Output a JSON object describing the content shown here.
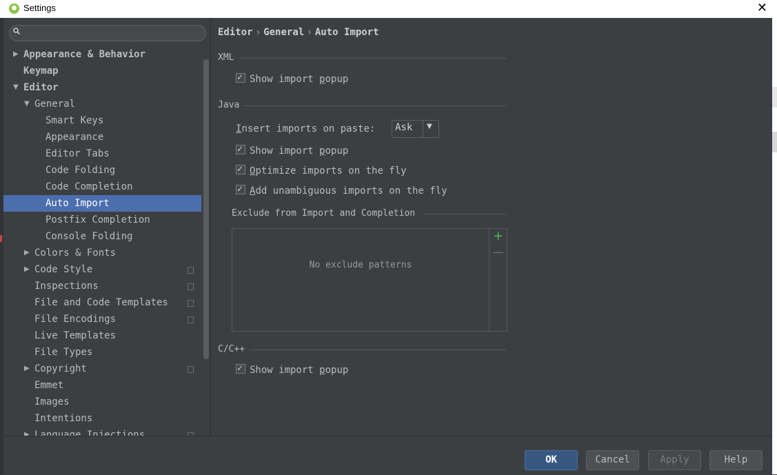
{
  "window": {
    "title": "Settings",
    "close": "✕"
  },
  "search": {
    "placeholder": "",
    "value": ""
  },
  "tree": [
    {
      "label": "Appearance & Behavior",
      "bold": true,
      "level": 0,
      "arrow": "▶",
      "project": false
    },
    {
      "label": "Keymap",
      "bold": true,
      "level": 0,
      "arrow": "",
      "project": false
    },
    {
      "label": "Editor",
      "bold": true,
      "level": 0,
      "arrow": "▼",
      "project": false
    },
    {
      "label": "General",
      "bold": false,
      "level": 1,
      "arrow": "▼",
      "project": false
    },
    {
      "label": "Smart Keys",
      "bold": false,
      "level": 2,
      "arrow": "",
      "project": false
    },
    {
      "label": "Appearance",
      "bold": false,
      "level": 2,
      "arrow": "",
      "project": false
    },
    {
      "label": "Editor Tabs",
      "bold": false,
      "level": 2,
      "arrow": "",
      "project": false
    },
    {
      "label": "Code Folding",
      "bold": false,
      "level": 2,
      "arrow": "",
      "project": false
    },
    {
      "label": "Code Completion",
      "bold": false,
      "level": 2,
      "arrow": "",
      "project": false
    },
    {
      "label": "Auto Import",
      "bold": false,
      "level": 2,
      "arrow": "",
      "project": false,
      "selected": true
    },
    {
      "label": "Postfix Completion",
      "bold": false,
      "level": 2,
      "arrow": "",
      "project": false
    },
    {
      "label": "Console Folding",
      "bold": false,
      "level": 2,
      "arrow": "",
      "project": false
    },
    {
      "label": "Colors & Fonts",
      "bold": false,
      "level": 1,
      "arrow": "▶",
      "project": false
    },
    {
      "label": "Code Style",
      "bold": false,
      "level": 1,
      "arrow": "▶",
      "project": true
    },
    {
      "label": "Inspections",
      "bold": false,
      "level": 1,
      "arrow": "",
      "project": true
    },
    {
      "label": "File and Code Templates",
      "bold": false,
      "level": 1,
      "arrow": "",
      "project": true
    },
    {
      "label": "File Encodings",
      "bold": false,
      "level": 1,
      "arrow": "",
      "project": true
    },
    {
      "label": "Live Templates",
      "bold": false,
      "level": 1,
      "arrow": "",
      "project": false
    },
    {
      "label": "File Types",
      "bold": false,
      "level": 1,
      "arrow": "",
      "project": false
    },
    {
      "label": "Copyright",
      "bold": false,
      "level": 1,
      "arrow": "▶",
      "project": true
    },
    {
      "label": "Emmet",
      "bold": false,
      "level": 1,
      "arrow": "",
      "project": false
    },
    {
      "label": "Images",
      "bold": false,
      "level": 1,
      "arrow": "",
      "project": false
    },
    {
      "label": "Intentions",
      "bold": false,
      "level": 1,
      "arrow": "",
      "project": false
    },
    {
      "label": "Language Injections",
      "bold": false,
      "level": 1,
      "arrow": "▶",
      "project": true
    }
  ],
  "breadcrumb": {
    "a": "Editor",
    "b": "General",
    "c": "Auto Import",
    "sep": "›"
  },
  "xml": {
    "title": "XML",
    "show_popup": {
      "pre": "Show import ",
      "u": "p",
      "post": "opup",
      "checked": true
    }
  },
  "java": {
    "title": "Java",
    "insert_label_u": "I",
    "insert_label_rest": "nsert imports on paste:",
    "insert_value": "Ask",
    "show_popup": {
      "pre": "Show import ",
      "u": "p",
      "post": "opup",
      "checked": true
    },
    "optimize": {
      "pre": "",
      "u": "O",
      "post": "ptimize imports on the fly",
      "checked": true
    },
    "add_unamb": {
      "pre": "",
      "u": "A",
      "post": "dd unambiguous imports on the fly",
      "checked": true
    },
    "exclude_title": "Exclude from Import and Completion",
    "exclude_empty": "No exclude patterns",
    "add_icon": "+",
    "remove_icon": "—"
  },
  "cpp": {
    "title": "C/C++",
    "show_popup": {
      "pre": "Show import ",
      "u": "p",
      "post": "opup",
      "checked": true
    }
  },
  "buttons": {
    "ok": "OK",
    "cancel": "Cancel",
    "apply": "Apply",
    "help": "Help"
  },
  "colors": {
    "selection": "#4b6eaf",
    "accent_green": "#5ab552",
    "ok_button": "#365880"
  }
}
